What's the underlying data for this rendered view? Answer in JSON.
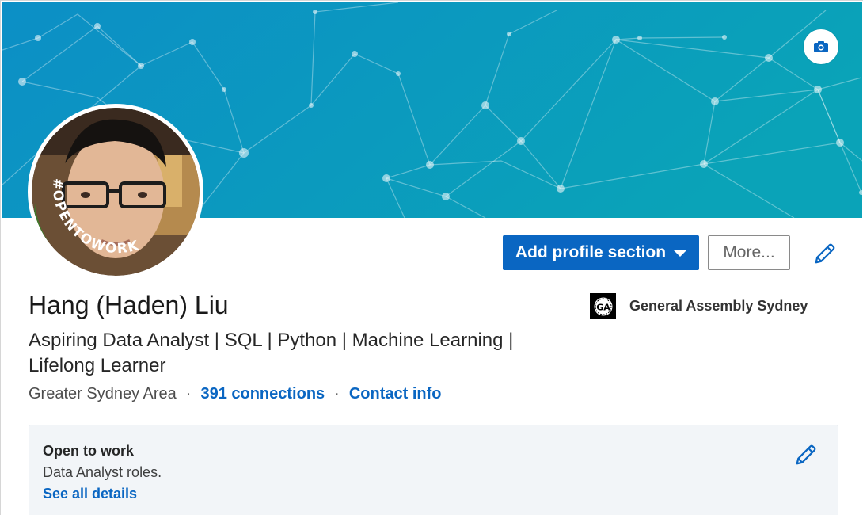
{
  "profile": {
    "name": "Hang (Haden) Liu",
    "headline": "Aspiring Data Analyst | SQL | Python | Machine Learning | Lifelong Learner",
    "location": "Greater Sydney Area",
    "connections": "391 connections",
    "contact_info": "Contact info",
    "separator": "·",
    "avatar_frame_text": "#OPENTOWORK"
  },
  "actions": {
    "add_section_label": "Add profile section",
    "more_label": "More..."
  },
  "education": {
    "school_name": "General Assembly Sydney",
    "logo_text": "GA"
  },
  "open_to_work": {
    "title": "Open to work",
    "description": "Data Analyst roles.",
    "link": "See all details"
  },
  "icons": {
    "camera": "camera-icon",
    "edit": "pencil-icon",
    "dropdown": "caret-down-icon"
  },
  "colors": {
    "primary": "#0a66c2",
    "banner_start": "#0c8fc6",
    "banner_end": "#0aa3b8",
    "open_to_work_green": "#3f7a2b",
    "card_bg": "#f2f5f8"
  }
}
